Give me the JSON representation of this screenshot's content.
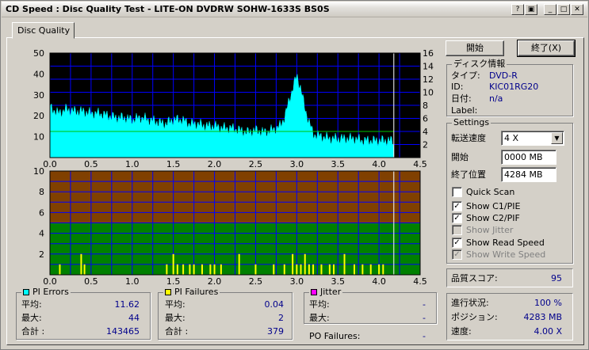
{
  "window": {
    "title": "CD Speed : Disc Quality Test - LITE-ON DVDRW SOHW-1633S BS0S",
    "buttons": [
      "help-icon",
      "restore-icon",
      "minimize",
      "maximize",
      "close"
    ]
  },
  "tab": {
    "label": "Disc Quality"
  },
  "controls": {
    "start_label": "開始",
    "stop_label": "終了(X)"
  },
  "disc_info": {
    "title": "ディスク情報",
    "type_label": "タイプ:",
    "type_value": "DVD-R",
    "id_label": "ID:",
    "id_value": "KIC01RG20",
    "date_label": "日付:",
    "date_value": "n/a",
    "label_label": "Label:",
    "label_value": ""
  },
  "settings": {
    "title": "Settings",
    "speed_label": "転送速度",
    "speed_value": "4 X",
    "start_label": "開始",
    "start_value": "0000 MB",
    "end_label": "終了位置",
    "end_value": "4284 MB",
    "quick_scan": "Quick Scan",
    "show_c1": "Show C1/PIE",
    "show_c2": "Show C2/PIF",
    "show_jitter": "Show Jitter",
    "show_read": "Show Read Speed",
    "show_write": "Show Write Speed"
  },
  "quality": {
    "label": "品質スコア:",
    "value": "95"
  },
  "progress": {
    "progress_label": "進行状況:",
    "progress_value": "100 %",
    "position_label": "ポジション:",
    "position_value": "4283 MB",
    "speed_label": "速度:",
    "speed_value": "4.00 X"
  },
  "pi_errors": {
    "title": "PI Errors",
    "color": "#00ffff",
    "avg_label": "平均:",
    "avg": "11.62",
    "max_label": "最大:",
    "max": "44",
    "total_label": "合計 :",
    "total": "143465"
  },
  "pi_failures": {
    "title": "PI Failures",
    "color": "#ffff00",
    "avg_label": "平均:",
    "avg": "0.04",
    "max_label": "最大:",
    "max": "2",
    "total_label": "合計 :",
    "total": "379"
  },
  "jitter": {
    "title": "Jitter",
    "color": "#ff00ff",
    "avg_label": "平均:",
    "avg": "-",
    "max_label": "最大:",
    "max": "-",
    "po_label": "PO Failures:",
    "po": "-"
  },
  "chart_data": [
    {
      "type": "area",
      "x_ticks": [
        "0.0",
        "0.5",
        "1.0",
        "1.5",
        "2.0",
        "2.5",
        "3.0",
        "3.5",
        "4.0",
        "4.5"
      ],
      "y_ticks_left": [
        "10",
        "20",
        "30",
        "40",
        "50"
      ],
      "y_ticks_right": [
        "2",
        "4",
        "6",
        "8",
        "10",
        "12",
        "14",
        "16"
      ],
      "xlim": [
        0,
        4.5
      ],
      "ylim": [
        0,
        50
      ],
      "y2lim": [
        0,
        16
      ],
      "colors": {
        "background": "#000000",
        "grid": "#0000ff",
        "errors": "#00ffff",
        "speed": "#00c000",
        "marker": "#ffffff"
      },
      "end_marker": 4.18,
      "series": [
        {
          "kind": "pi_errors",
          "x": [
            0,
            0.1,
            0.2,
            0.3,
            0.4,
            0.5,
            0.6,
            0.7,
            0.8,
            0.9,
            1.0,
            1.1,
            1.2,
            1.3,
            1.4,
            1.5,
            1.6,
            1.7,
            1.8,
            1.9,
            2.0,
            2.1,
            2.2,
            2.3,
            2.4,
            2.5,
            2.6,
            2.7,
            2.8,
            2.85,
            2.9,
            2.95,
            3.0,
            3.05,
            3.1,
            3.2,
            3.3,
            3.4,
            3.5,
            3.6,
            3.7,
            3.8,
            3.9,
            4.0,
            4.1,
            4.18
          ],
          "y": [
            24,
            21,
            23,
            22,
            22,
            21,
            21,
            20,
            19,
            19,
            18,
            19,
            18,
            17,
            16,
            18,
            18,
            16,
            16,
            15,
            15,
            14,
            14,
            13,
            12,
            13,
            12,
            13,
            15,
            19,
            26,
            33,
            39,
            33,
            23,
            11,
            10,
            9,
            9,
            9,
            9,
            8,
            8,
            8,
            8,
            8
          ]
        },
        {
          "kind": "read_speed",
          "x": [
            0,
            4.18
          ],
          "y": [
            4,
            4
          ]
        }
      ]
    },
    {
      "type": "bar",
      "x_ticks": [
        "0.0",
        "0.5",
        "1.0",
        "1.5",
        "2.0",
        "2.5",
        "3.0",
        "3.5",
        "4.0",
        "4.5"
      ],
      "y_ticks": [
        "2",
        "4",
        "6",
        "8",
        "10"
      ],
      "xlim": [
        0,
        4.5
      ],
      "ylim": [
        0,
        10
      ],
      "colors": {
        "band_low": "#00ff00",
        "band_mid": "#008000",
        "band_high": "#804000",
        "grid": "#0000ff",
        "bars": "#ffff00",
        "marker": "#ffffff"
      },
      "end_marker": 4.18,
      "series": [
        {
          "kind": "pi_failures",
          "x": [
            0.12,
            0.38,
            0.42,
            1.42,
            1.5,
            1.55,
            1.62,
            1.7,
            1.75,
            1.85,
            1.95,
            2.0,
            2.08,
            2.3,
            2.5,
            2.72,
            2.85,
            2.95,
            3.0,
            3.05,
            3.1,
            3.15,
            3.2,
            3.3,
            3.4,
            3.45,
            3.58,
            3.7,
            3.8,
            3.9,
            4.0,
            4.05
          ],
          "y": [
            1,
            2,
            1,
            1,
            2,
            1,
            1,
            1,
            1,
            1,
            1,
            1,
            1,
            2,
            1,
            1,
            1,
            2,
            1,
            1,
            2,
            1,
            1,
            1,
            1,
            1,
            2,
            1,
            1,
            1,
            1,
            1
          ]
        }
      ]
    }
  ]
}
